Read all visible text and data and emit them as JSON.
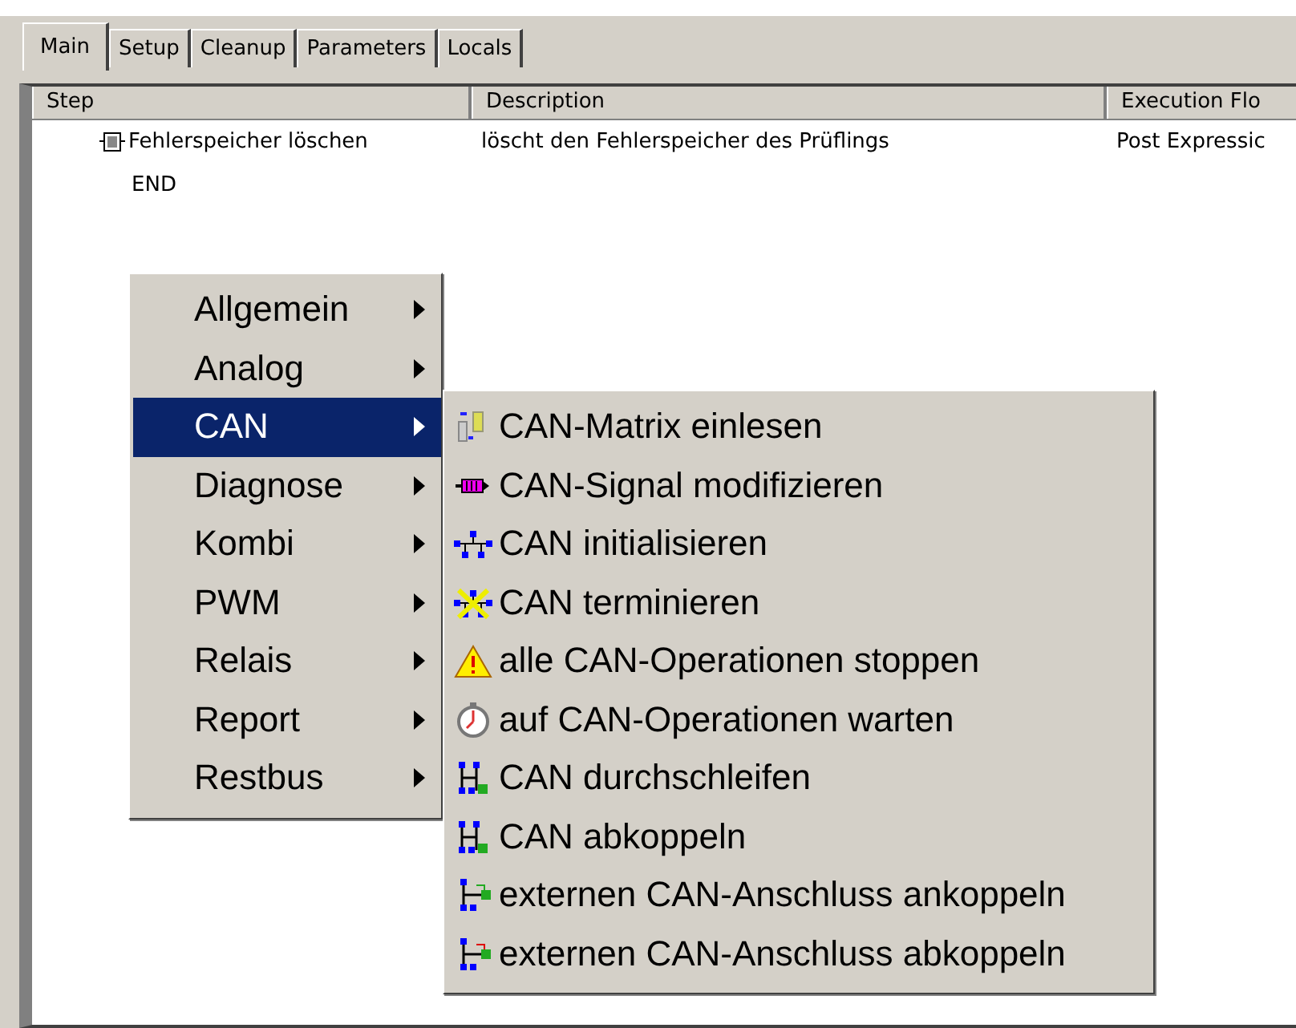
{
  "tabs": [
    {
      "label": "Main",
      "selected": true
    },
    {
      "label": "Setup",
      "selected": false
    },
    {
      "label": "Cleanup",
      "selected": false
    },
    {
      "label": "Parameters",
      "selected": false
    },
    {
      "label": "Locals",
      "selected": false
    }
  ],
  "table": {
    "columns": [
      "Step",
      "Description",
      "Execution Flo"
    ],
    "rows": [
      {
        "step": "Fehlerspeicher löschen",
        "description": "löscht den Fehlerspeicher des Prüflings",
        "column_3": "Post Expressic",
        "kind": "step"
      },
      {
        "step": "END",
        "kind": "end"
      }
    ]
  },
  "context_menu": {
    "items": [
      {
        "label": "Allgemein",
        "selected": false
      },
      {
        "label": "Analog",
        "selected": false
      },
      {
        "label": "CAN",
        "selected": true
      },
      {
        "label": "Diagnose",
        "selected": false
      },
      {
        "label": "Kombi",
        "selected": false
      },
      {
        "label": "PWM",
        "selected": false
      },
      {
        "label": "Relais",
        "selected": false
      },
      {
        "label": "Report",
        "selected": false
      },
      {
        "label": "Restbus",
        "selected": false
      }
    ]
  },
  "submenu": {
    "items": [
      {
        "label": "CAN-Matrix einlesen"
      },
      {
        "label": "CAN-Signal modifizieren"
      },
      {
        "label": "CAN initialisieren"
      },
      {
        "label": "CAN terminieren"
      },
      {
        "label": "alle CAN-Operationen stoppen"
      },
      {
        "label": "auf CAN-Operationen warten"
      },
      {
        "label": "CAN durchschleifen"
      },
      {
        "label": "CAN abkoppeln"
      },
      {
        "label": "externen CAN-Anschluss ankoppeln"
      },
      {
        "label": "externen CAN-Anschluss abkoppeln"
      }
    ]
  }
}
